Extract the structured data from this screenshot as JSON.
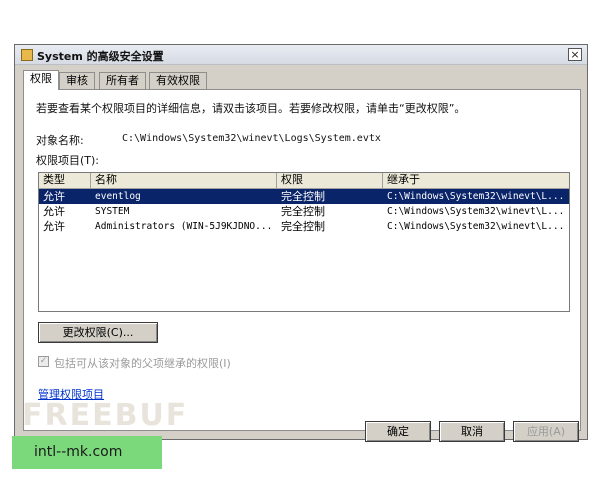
{
  "window": {
    "title": "System 的高级安全设置",
    "close_label": "×"
  },
  "tabs": [
    {
      "label": "权限",
      "active": true
    },
    {
      "label": "审核",
      "active": false
    },
    {
      "label": "所有者",
      "active": false
    },
    {
      "label": "有效权限",
      "active": false
    }
  ],
  "panel": {
    "instructions": "若要查看某个权限项目的详细信息，请双击该项目。若要修改权限，请单击“更改权限”。",
    "object_name_label": "对象名称:",
    "object_name_value": "C:\\Windows\\System32\\winevt\\Logs\\System.evtx",
    "entries_label": "权限项目(T):"
  },
  "permissions_table": {
    "columns": [
      "类型",
      "名称",
      "权限",
      "继承于"
    ],
    "rows": [
      {
        "type": "允许",
        "name": "eventlog",
        "permission": "完全控制",
        "inherited_from": "C:\\Windows\\System32\\winevt\\L...",
        "selected": true
      },
      {
        "type": "允许",
        "name": "SYSTEM",
        "permission": "完全控制",
        "inherited_from": "C:\\Windows\\System32\\winevt\\L...",
        "selected": false
      },
      {
        "type": "允许",
        "name": "Administrators (WIN-5J9KJDNO...",
        "permission": "完全控制",
        "inherited_from": "C:\\Windows\\System32\\winevt\\L...",
        "selected": false
      }
    ]
  },
  "change_permissions_button": "更改权限(C)...",
  "inherit_checkbox": {
    "label": "包括可从该对象的父项继承的权限(I)",
    "checked": true,
    "mark": "✓"
  },
  "manage_link": "管理权限项目",
  "footer_buttons": {
    "ok": "确定",
    "cancel": "取消",
    "apply": "应用(A)"
  },
  "watermark": "FREEBUF",
  "badge_text": "intl--mk.com"
}
